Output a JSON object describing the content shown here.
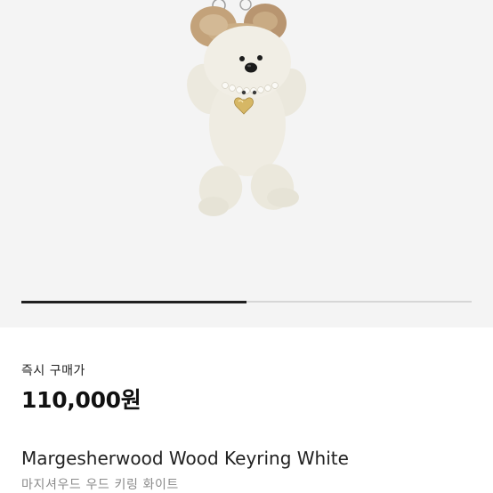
{
  "product": {
    "image_description": "white plush bear keyring",
    "price_label": "즉시 구매가",
    "price": "110,000원",
    "title": "Margesherwood Wood Keyring White",
    "subtitle": "마지셔우드 우드 키링 화이트"
  },
  "gallery": {
    "progress": 0.5
  },
  "colors": {
    "background": "#f4f4f4",
    "indicator_active": "#1f1f1f",
    "indicator_track": "#d6d6d6"
  }
}
